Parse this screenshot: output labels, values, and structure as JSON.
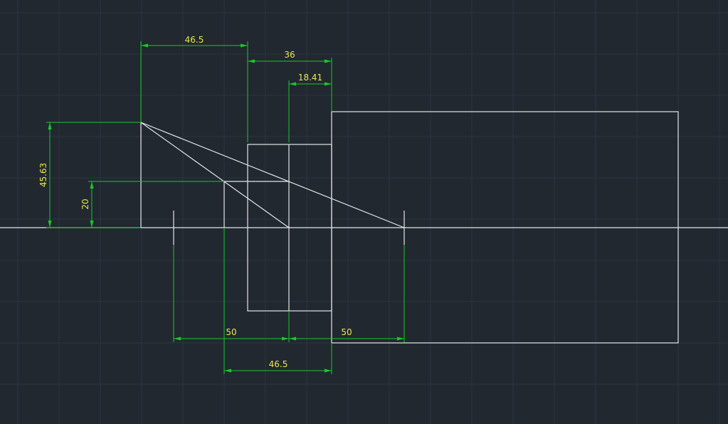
{
  "colors": {
    "background": "#212830",
    "grid": "#2c3540",
    "geometry": "#e6e6e6",
    "dimension_line": "#18c82a",
    "dimension_text": "#e8e84a"
  },
  "dimensions": {
    "top_465": "46.5",
    "top_36": "36",
    "top_1841": "18.41",
    "left_4563": "45.63",
    "left_20": "20",
    "bottom_50_left": "50",
    "bottom_50_right": "50",
    "bottom_465": "46.5"
  }
}
